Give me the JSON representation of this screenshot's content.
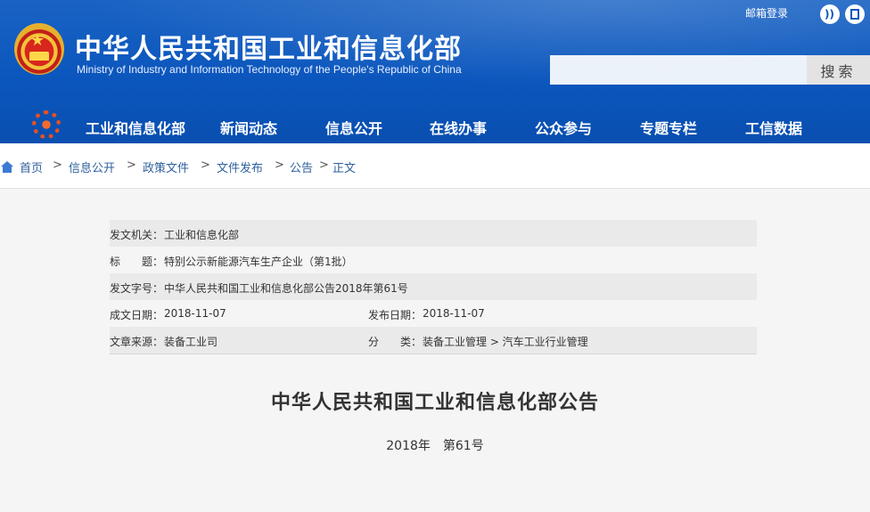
{
  "header": {
    "title_cn": "中华人民共和国工业和信息化部",
    "title_en": "Ministry of Industry and Information Technology of the People's Republic of China",
    "mail_login": "邮箱登录",
    "rss_icon": "rss-icon",
    "app_icon": "app-icon",
    "search": {
      "placeholder": "",
      "button_label": "搜索"
    }
  },
  "nav": {
    "items": [
      "工业和信息化部",
      "新闻动态",
      "信息公开",
      "在线办事",
      "公众参与",
      "专题专栏",
      "工信数据"
    ]
  },
  "breadcrumb": {
    "items": [
      "首页",
      "信息公开",
      "政策文件",
      "文件发布",
      "公告",
      "正文"
    ],
    "separator": ">"
  },
  "meta": {
    "issuer_label": "发文机关：",
    "issuer_value": "工业和信息化部",
    "subject_label": "标　　题：",
    "subject_value": "特别公示新能源汽车生产企业（第1批）",
    "docnum_label": "发文字号：",
    "docnum_value": "中华人民共和国工业和信息化部公告2018年第61号",
    "created_label": "成文日期：",
    "created_value": "2018-11-07",
    "published_label": "发布日期：",
    "published_value": "2018-11-07",
    "source_label": "文章来源：",
    "source_value": "装备工业司",
    "category_label": "分　　类：",
    "category_value": "装备工业管理 > 汽车工业行业管理"
  },
  "document": {
    "title": "中华人民共和国工业和信息化部公告",
    "number": "2018年　第61号"
  },
  "colors": {
    "header_blue": "#0b56bd",
    "link_blue": "#2f5f9e",
    "row_shade": "#eaeaea"
  }
}
